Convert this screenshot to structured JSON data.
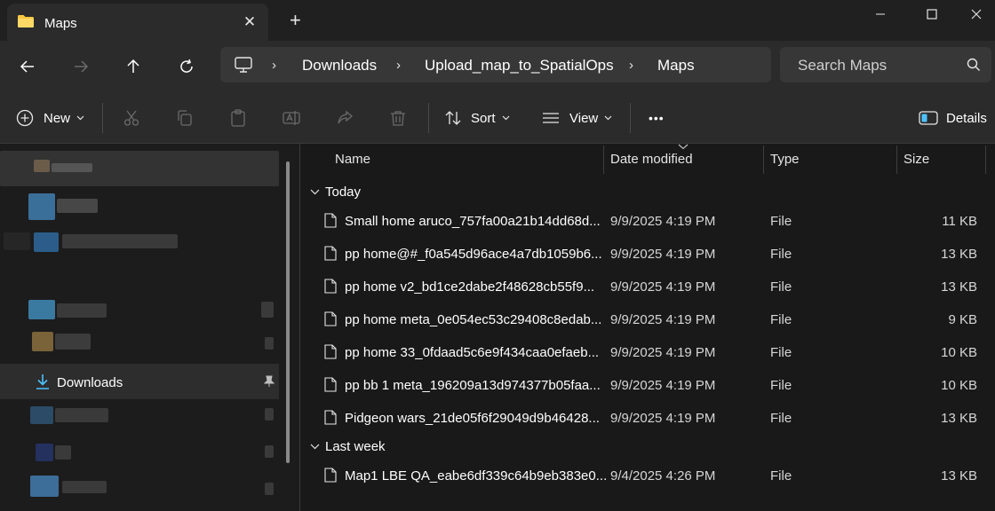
{
  "window": {
    "tab_title": "Maps",
    "tab_close": "✕",
    "new_tab": "+"
  },
  "nav": {
    "breadcrumbs": [
      "Downloads",
      "Upload_map_to_SpatialOps",
      "Maps"
    ],
    "search_placeholder": "Search Maps"
  },
  "toolbar": {
    "new_label": "New",
    "sort_label": "Sort",
    "view_label": "View",
    "more_label": "•••",
    "details_label": "Details"
  },
  "sidebar": {
    "downloads_label": "Downloads"
  },
  "columns": {
    "name": "Name",
    "date": "Date modified",
    "type": "Type",
    "size": "Size"
  },
  "groups": [
    {
      "label": "Today",
      "files": [
        {
          "name": "Small home aruco_757fa00a21b14dd68d...",
          "date": "9/9/2025 4:19 PM",
          "type": "File",
          "size": "11 KB"
        },
        {
          "name": "pp home@#_f0a545d96ace4a7db1059b6...",
          "date": "9/9/2025 4:19 PM",
          "type": "File",
          "size": "13 KB"
        },
        {
          "name": "pp home v2_bd1ce2dabe2f48628cb55f9...",
          "date": "9/9/2025 4:19 PM",
          "type": "File",
          "size": "13 KB"
        },
        {
          "name": "pp home meta_0e054ec53c29408c8edab...",
          "date": "9/9/2025 4:19 PM",
          "type": "File",
          "size": "9 KB"
        },
        {
          "name": "pp home 33_0fdaad5c6e9f434caa0efaeb...",
          "date": "9/9/2025 4:19 PM",
          "type": "File",
          "size": "10 KB"
        },
        {
          "name": "pp bb 1 meta_196209a13d974377b05faa...",
          "date": "9/9/2025 4:19 PM",
          "type": "File",
          "size": "10 KB"
        },
        {
          "name": "Pidgeon wars_21de05f6f29049d9b46428...",
          "date": "9/9/2025 4:19 PM",
          "type": "File",
          "size": "13 KB"
        }
      ]
    },
    {
      "label": "Last week",
      "files": [
        {
          "name": "Map1 LBE QA_eabe6df339c64b9eb383e0...",
          "date": "9/4/2025 4:26 PM",
          "type": "File",
          "size": "13 KB"
        }
      ]
    }
  ],
  "colors": {
    "accent_folder": "#f8c842",
    "download_arrow": "#4cc2ff",
    "background": "#191919"
  }
}
